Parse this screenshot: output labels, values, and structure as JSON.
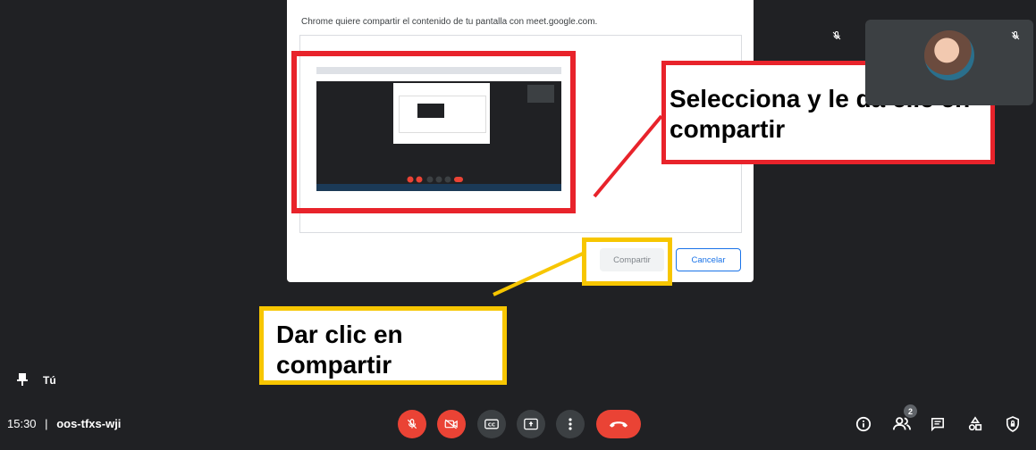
{
  "dialog": {
    "prompt": "Chrome quiere compartir el contenido de tu pantalla con meet.google.com.",
    "share_label": "Compartir",
    "cancel_label": "Cancelar"
  },
  "annotations": {
    "red_callout": "Selecciona y le da clic en compartir",
    "yellow_callout": "Dar clic en compartir",
    "red_color": "#e8232b",
    "yellow_color": "#f7c600"
  },
  "self_tile": {
    "label": "Tú"
  },
  "meeting": {
    "time": "15:30",
    "separator": "|",
    "code": "oos-tfxs-wji"
  },
  "people": {
    "count": "2"
  },
  "icons": {
    "mic_off": "mic-off-icon",
    "camera_off": "camera-off-icon",
    "captions": "captions-icon",
    "present": "present-icon",
    "more": "more-icon",
    "hangup": "phone-hangup-icon",
    "info": "info-icon",
    "people": "people-icon",
    "chat": "chat-icon",
    "activities": "activities-icon",
    "host": "host-controls-icon",
    "pin": "pin-icon"
  },
  "colors": {
    "background": "#202124",
    "danger": "#ea4335",
    "accent": "#1a73e8"
  }
}
